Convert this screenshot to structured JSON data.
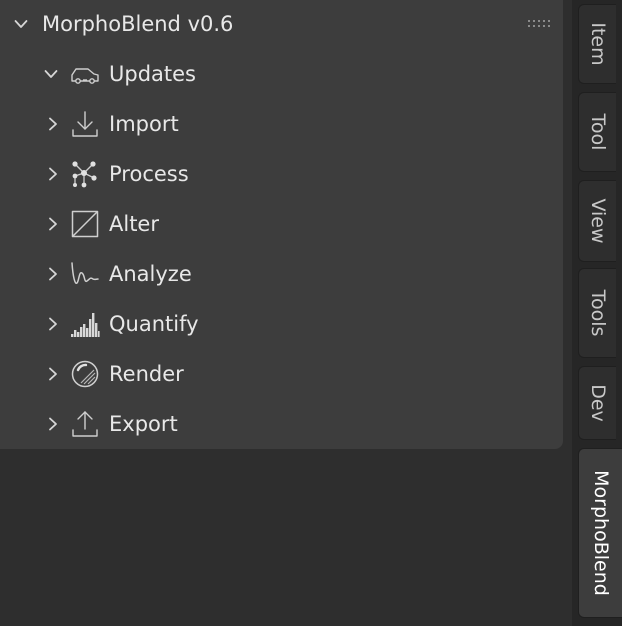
{
  "panel": {
    "title": "MorphoBlend v0.6",
    "expanded": true
  },
  "sections": [
    {
      "label": "Updates",
      "icon": "car-icon",
      "expanded": true
    },
    {
      "label": "Import",
      "icon": "import-icon",
      "expanded": false
    },
    {
      "label": "Process",
      "icon": "nodes-icon",
      "expanded": false
    },
    {
      "label": "Alter",
      "icon": "alter-icon",
      "expanded": false
    },
    {
      "label": "Analyze",
      "icon": "waveform-icon",
      "expanded": false
    },
    {
      "label": "Quantify",
      "icon": "histogram-icon",
      "expanded": false
    },
    {
      "label": "Render",
      "icon": "render-icon",
      "expanded": false
    },
    {
      "label": "Export",
      "icon": "export-icon",
      "expanded": false
    }
  ],
  "tabs": [
    {
      "label": "Item",
      "active": false
    },
    {
      "label": "Tool",
      "active": false
    },
    {
      "label": "View",
      "active": false
    },
    {
      "label": "Tools",
      "active": false
    },
    {
      "label": "Dev",
      "active": false
    },
    {
      "label": "MorphoBlend",
      "active": true
    }
  ],
  "colors": {
    "panel_bg": "#3d3d3d",
    "region_bg": "#2e2e2e",
    "tabstrip_bg": "#262626",
    "text": "#e8e8e8"
  }
}
